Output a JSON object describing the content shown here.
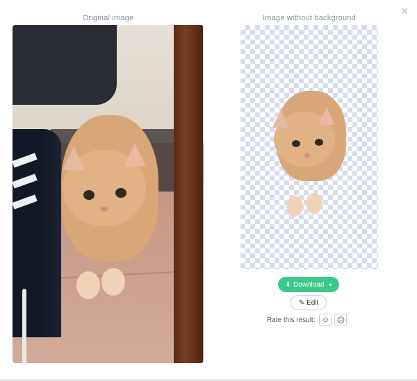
{
  "dialog": {
    "close_symbol": "×",
    "original_title": "Original image",
    "result_title": "Image without background"
  },
  "actions": {
    "download_label": "Download",
    "download_caret": "▾",
    "edit_label": "Edit",
    "rate_label": "Rate this result:",
    "rate_good_symbol": "☺",
    "rate_bad_symbol": "☹"
  },
  "colors": {
    "download_bg": "#3cc88a",
    "checker": "#d6dcef"
  },
  "icons": {
    "download": "download-icon",
    "edit": "pencil-icon",
    "close": "close-icon",
    "good": "smile-icon",
    "bad": "frown-icon"
  }
}
